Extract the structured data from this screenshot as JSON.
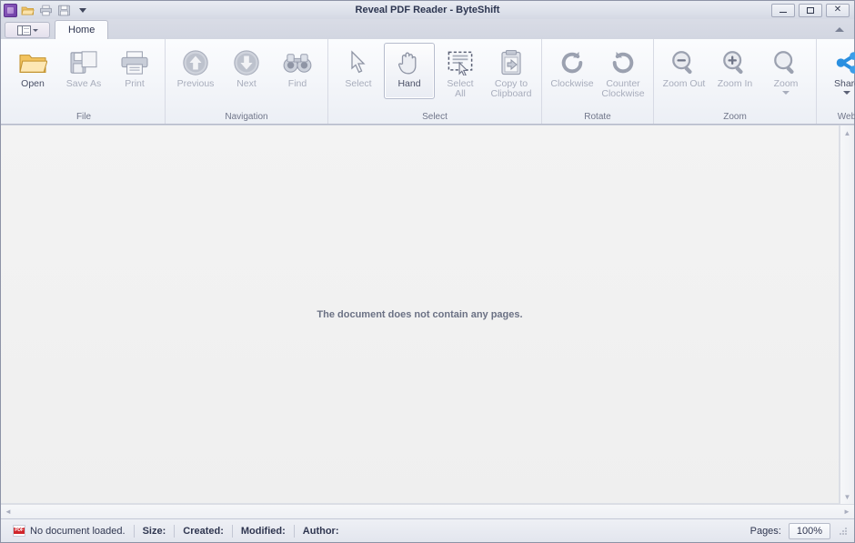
{
  "window": {
    "title": "Reveal PDF Reader - ByteShift",
    "minimize_label": "—",
    "maximize_label": "□",
    "close_label": "✕"
  },
  "quick_access": {
    "items": [
      {
        "name": "app-icon",
        "label": "Reveal PDF Reader"
      },
      {
        "name": "open-icon",
        "label": "Open"
      },
      {
        "name": "print-icon",
        "label": "Print"
      },
      {
        "name": "save-icon",
        "label": "Save"
      },
      {
        "name": "customize-icon",
        "label": "Customize Quick Access Toolbar"
      }
    ]
  },
  "tabstrip": {
    "view_button_label": "View layout",
    "tabs": [
      {
        "label": "Home",
        "active": true
      }
    ],
    "collapse_ribbon_label": "Collapse the Ribbon"
  },
  "ribbon": {
    "groups": [
      {
        "name": "file",
        "label": "File",
        "launcher": false,
        "buttons": [
          {
            "name": "open",
            "label": "Open",
            "icon": "folder-open-icon",
            "enabled": true,
            "active": false,
            "dropdown": false
          },
          {
            "name": "save-as",
            "label": "Save As",
            "icon": "save-as-icon",
            "enabled": false,
            "active": false,
            "dropdown": false
          },
          {
            "name": "print",
            "label": "Print",
            "icon": "printer-icon",
            "enabled": false,
            "active": false,
            "dropdown": false
          }
        ]
      },
      {
        "name": "navigation",
        "label": "Navigation",
        "launcher": false,
        "buttons": [
          {
            "name": "previous",
            "label": "Previous",
            "icon": "arrow-up-circle-icon",
            "enabled": false,
            "active": false,
            "dropdown": false
          },
          {
            "name": "next",
            "label": "Next",
            "icon": "arrow-down-circle-icon",
            "enabled": false,
            "active": false,
            "dropdown": false
          },
          {
            "name": "find",
            "label": "Find",
            "icon": "binoculars-icon",
            "enabled": false,
            "active": false,
            "dropdown": false
          }
        ]
      },
      {
        "name": "select",
        "label": "Select",
        "launcher": true,
        "buttons": [
          {
            "name": "select-tool",
            "label": "Select",
            "icon": "cursor-arrow-icon",
            "enabled": false,
            "active": false,
            "dropdown": false
          },
          {
            "name": "hand-tool",
            "label": "Hand",
            "icon": "hand-icon",
            "enabled": true,
            "active": true,
            "dropdown": false
          },
          {
            "name": "select-all",
            "label": "Select\nAll",
            "icon": "select-all-icon",
            "enabled": false,
            "active": false,
            "dropdown": false
          },
          {
            "name": "copy-to-clipboard",
            "label": "Copy to\nClipboard",
            "icon": "clipboard-icon",
            "enabled": false,
            "active": false,
            "dropdown": false
          }
        ]
      },
      {
        "name": "rotate",
        "label": "Rotate",
        "launcher": true,
        "buttons": [
          {
            "name": "rotate-clockwise",
            "label": "Clockwise",
            "icon": "rotate-cw-icon",
            "enabled": false,
            "active": false,
            "dropdown": false
          },
          {
            "name": "rotate-counter-clockwise",
            "label": "Counter\nClockwise",
            "icon": "rotate-ccw-icon",
            "enabled": false,
            "active": false,
            "dropdown": false
          }
        ]
      },
      {
        "name": "zoom",
        "label": "Zoom",
        "launcher": false,
        "buttons": [
          {
            "name": "zoom-out",
            "label": "Zoom Out",
            "icon": "magnifier-minus-icon",
            "enabled": false,
            "active": false,
            "dropdown": false
          },
          {
            "name": "zoom-in",
            "label": "Zoom In",
            "icon": "magnifier-plus-icon",
            "enabled": false,
            "active": false,
            "dropdown": false
          },
          {
            "name": "zoom-menu",
            "label": "Zoom",
            "icon": "magnifier-icon",
            "enabled": false,
            "active": false,
            "dropdown": true
          }
        ]
      },
      {
        "name": "web",
        "label": "Web",
        "launcher": true,
        "buttons": [
          {
            "name": "share",
            "label": "Share",
            "icon": "share-nodes-icon",
            "enabled": true,
            "active": false,
            "dropdown": true
          }
        ]
      }
    ]
  },
  "document": {
    "empty_message": "The document does not contain any pages."
  },
  "statusbar": {
    "document_state": "No document loaded.",
    "size_label": "Size:",
    "created_label": "Created:",
    "modified_label": "Modified:",
    "author_label": "Author:",
    "pages_label": "Pages:",
    "zoom_value": "100%"
  },
  "colors": {
    "accent_share": "#2a8fe0",
    "title_text": "#2c3550",
    "disabled_text": "#a8adbc",
    "pdf_red": "#d0252b",
    "app_icon_purple": "#6f3fa6"
  }
}
